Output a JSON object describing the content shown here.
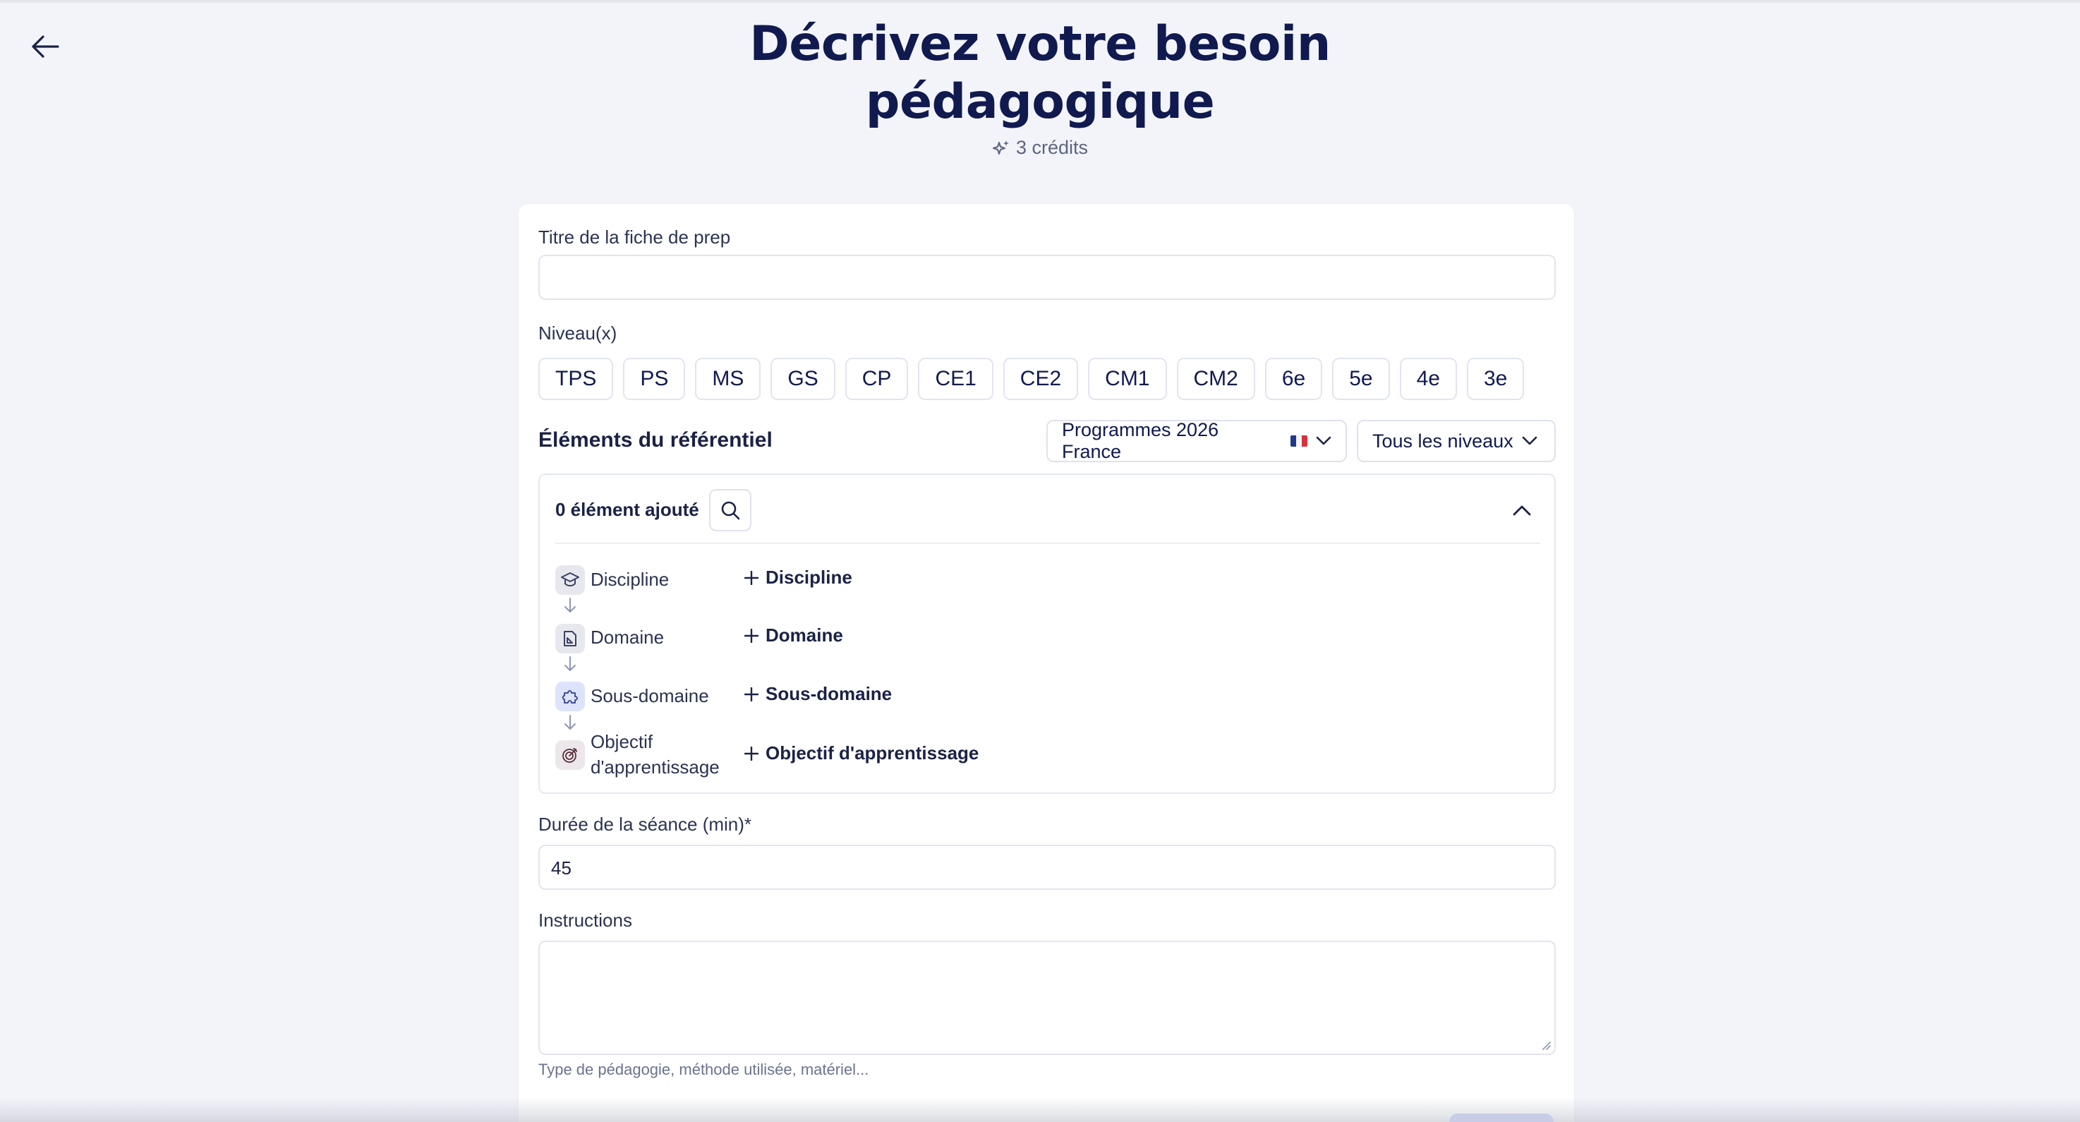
{
  "header": {
    "title_line1": "Décrivez votre besoin",
    "title_line2": "pédagogique",
    "credits": "3 crédits"
  },
  "form": {
    "title_field": {
      "label": "Titre de la fiche de prep",
      "value": ""
    },
    "levels": {
      "label": "Niveau(x)",
      "options": [
        "TPS",
        "PS",
        "MS",
        "GS",
        "CP",
        "CE1",
        "CE2",
        "CM1",
        "CM2",
        "6e",
        "5e",
        "4e",
        "3e"
      ]
    },
    "referentiel": {
      "title": "Éléments du référentiel",
      "program_select": "Programmes 2026 France",
      "level_select": "Tous les niveaux",
      "count_label": "0 élément ajouté",
      "rows": [
        {
          "label": "Discipline",
          "add": "Discipline",
          "icon": "graduation-cap-icon",
          "icon_bg": "#e7e8ee"
        },
        {
          "label": "Domaine",
          "add": "Domaine",
          "icon": "chart-page-icon",
          "icon_bg": "#e7e8ee"
        },
        {
          "label": "Sous-domaine",
          "add": "Sous-domaine",
          "icon": "puzzle-icon",
          "icon_bg": "#dde3fb"
        },
        {
          "label_line1": "Objectif",
          "label_line2": "d'apprentissage",
          "add": "Objectif d'apprentissage",
          "icon": "target-icon",
          "icon_bg": "#ebe7ea"
        }
      ]
    },
    "duration": {
      "label": "Durée de la séance (min)*",
      "value": "45"
    },
    "instructions": {
      "label": "Instructions",
      "value": "",
      "hint": "Type de pédagogie, méthode utilisée, matériel..."
    }
  },
  "colors": {
    "background": "#f3f4f9",
    "text_primary": "#101a4f",
    "border": "#e2e5ee",
    "accent_light": "#dde3fb"
  }
}
